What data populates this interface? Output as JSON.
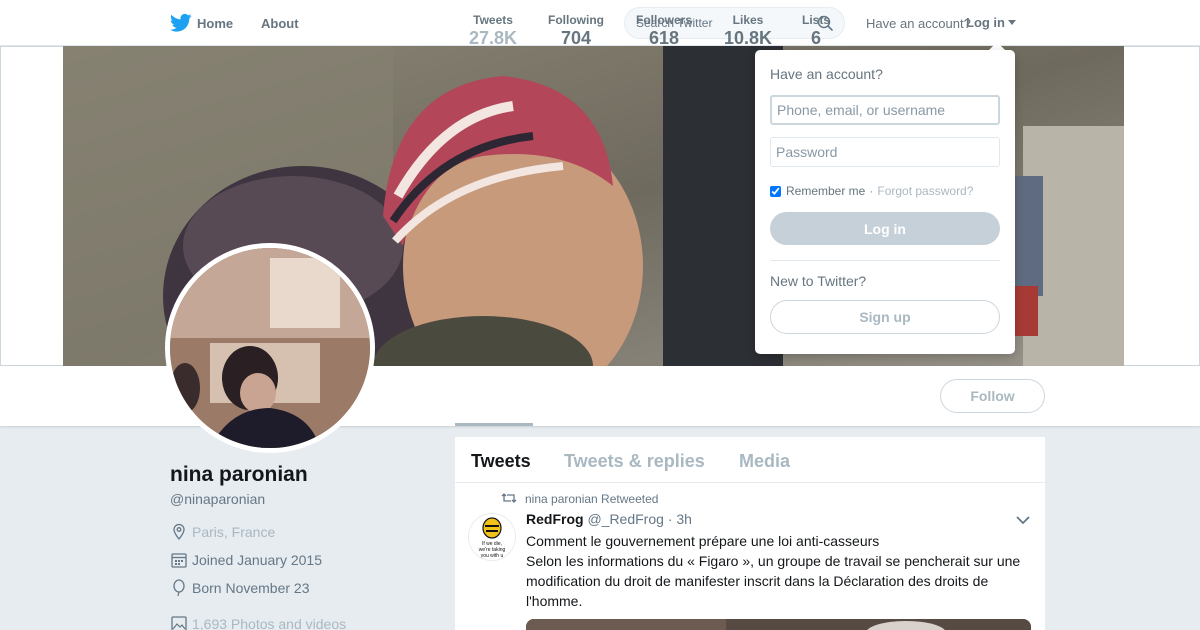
{
  "nav": {
    "home_label": "Home",
    "about_label": "About",
    "search_placeholder": "Search Twitter",
    "have_account_text": "Have an account?",
    "login_label": "Log in",
    "brand_color": "#1da1f2"
  },
  "profile": {
    "name": "nina paronian",
    "handle": "@ninaparonian",
    "location": "Paris, France",
    "joined": "Joined January 2015",
    "born": "Born November 23",
    "photos": "1,693 Photos and videos"
  },
  "stats": [
    {
      "label": "Tweets",
      "value": "27.8K"
    },
    {
      "label": "Following",
      "value": "704"
    },
    {
      "label": "Followers",
      "value": "618"
    },
    {
      "label": "Likes",
      "value": "10.8K"
    },
    {
      "label": "Lists",
      "value": "6"
    }
  ],
  "follow_label": "Follow",
  "timeline": {
    "tabs": [
      "Tweets",
      "Tweets & replies",
      "Media"
    ],
    "tweet": {
      "retweet_context": "nina paronian Retweeted",
      "author_name": "RedFrog",
      "author_handle": "@_RedFrog",
      "time": "· 3h",
      "text_line1": "Comment le gouvernement prépare une loi anti-casseurs",
      "text_line2": "Selon les informations du « Figaro », un groupe de travail se pencherait  sur une modification du droit de manifester inscrit dans la Déclaration  des droits de l'homme.",
      "avatar_text": "If we die, we're taking you with u"
    }
  },
  "login_dropdown": {
    "title": "Have an account?",
    "username_placeholder": "Phone, email, or username",
    "password_placeholder": "Password",
    "remember_label": "Remember me",
    "separator": "·",
    "forgot_label": "Forgot password?",
    "login_button": "Log in",
    "new_text": "New to Twitter?",
    "signup_button": "Sign up"
  }
}
